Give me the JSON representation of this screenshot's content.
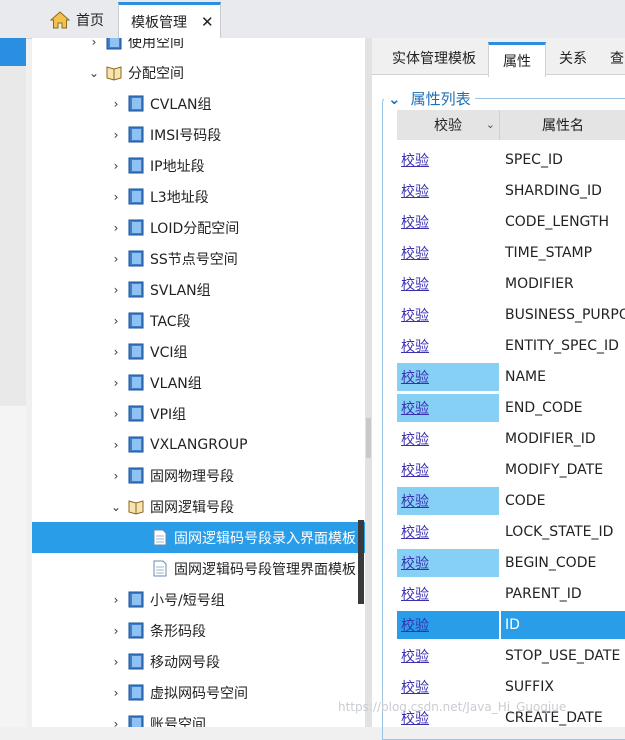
{
  "tabs": [
    {
      "label": "首页"
    },
    {
      "label": "模板管理",
      "close": "✕"
    }
  ],
  "tree": [
    {
      "label": "使用空间",
      "arrow": "›",
      "icon": "blue"
    },
    {
      "label": "分配空间",
      "arrow": "⌄",
      "icon": "book"
    },
    {
      "label": "CVLAN组",
      "arrow": "›",
      "icon": "blue"
    },
    {
      "label": "IMSI号码段",
      "arrow": "›",
      "icon": "blue"
    },
    {
      "label": "IP地址段",
      "arrow": "›",
      "icon": "blue"
    },
    {
      "label": "L3地址段",
      "arrow": "›",
      "icon": "blue"
    },
    {
      "label": "LOID分配空间",
      "arrow": "›",
      "icon": "blue"
    },
    {
      "label": "SS节点号空间",
      "arrow": "›",
      "icon": "blue"
    },
    {
      "label": "SVLAN组",
      "arrow": "›",
      "icon": "blue"
    },
    {
      "label": "TAC段",
      "arrow": "›",
      "icon": "blue"
    },
    {
      "label": "VCI组",
      "arrow": "›",
      "icon": "blue"
    },
    {
      "label": "VLAN组",
      "arrow": "›",
      "icon": "blue"
    },
    {
      "label": "VPI组",
      "arrow": "›",
      "icon": "blue"
    },
    {
      "label": "VXLANGROUP",
      "arrow": "›",
      "icon": "blue"
    },
    {
      "label": "固网物理号段",
      "arrow": "›",
      "icon": "blue"
    },
    {
      "label": "固网逻辑号段",
      "arrow": "⌄",
      "icon": "book"
    },
    {
      "label": "固网逻辑码号段录入界面模板",
      "arrow": "",
      "icon": "doc",
      "selected": true
    },
    {
      "label": "固网逻辑码号段管理界面模板",
      "arrow": "",
      "icon": "doc"
    },
    {
      "label": "小号/短号组",
      "arrow": "›",
      "icon": "blue"
    },
    {
      "label": "条形码段",
      "arrow": "›",
      "icon": "blue"
    },
    {
      "label": "移动网号段",
      "arrow": "›",
      "icon": "blue"
    },
    {
      "label": "虚拟网码号空间",
      "arrow": "›",
      "icon": "blue"
    },
    {
      "label": "账号空间",
      "arrow": "›",
      "icon": "blue"
    }
  ],
  "subtabs": [
    {
      "label": "实体管理模板"
    },
    {
      "label": "属性"
    },
    {
      "label": "关系"
    },
    {
      "label": "查"
    }
  ],
  "legend": {
    "chevron": "⌄",
    "label": "属性列表"
  },
  "grid": {
    "headers": [
      "校验",
      "属性名"
    ],
    "sort_icon": "⌄",
    "rows": [
      {
        "check": "校验",
        "name": "SPEC_ID",
        "state": ""
      },
      {
        "check": "校验",
        "name": "SHARDING_ID",
        "state": ""
      },
      {
        "check": "校验",
        "name": "CODE_LENGTH",
        "state": ""
      },
      {
        "check": "校验",
        "name": "TIME_STAMP",
        "state": ""
      },
      {
        "check": "校验",
        "name": "MODIFIER",
        "state": ""
      },
      {
        "check": "校验",
        "name": "BUSINESS_PURPOSE",
        "state": ""
      },
      {
        "check": "校验",
        "name": "ENTITY_SPEC_ID",
        "state": ""
      },
      {
        "check": "校验",
        "name": "NAME",
        "state": "hl"
      },
      {
        "check": "校验",
        "name": "END_CODE",
        "state": "hl"
      },
      {
        "check": "校验",
        "name": "MODIFIER_ID",
        "state": ""
      },
      {
        "check": "校验",
        "name": "MODIFY_DATE",
        "state": ""
      },
      {
        "check": "校验",
        "name": "CODE",
        "state": "hl"
      },
      {
        "check": "校验",
        "name": "LOCK_STATE_ID",
        "state": ""
      },
      {
        "check": "校验",
        "name": "BEGIN_CODE",
        "state": "hl"
      },
      {
        "check": "校验",
        "name": "PARENT_ID",
        "state": ""
      },
      {
        "check": "校验",
        "name": "ID",
        "state": "sel"
      },
      {
        "check": "校验",
        "name": "STOP_USE_DATE",
        "state": ""
      },
      {
        "check": "校验",
        "name": "SUFFIX",
        "state": ""
      },
      {
        "check": "校验",
        "name": "CREATE_DATE",
        "state": ""
      }
    ]
  },
  "watermark": "https://blog.csdn.net/Java_Hi_Guoqiue",
  "colors": {
    "accent": "#2a8fe0",
    "selection": "#2a9de8",
    "highlight": "#86cff5",
    "link": "#3a2fb3"
  }
}
